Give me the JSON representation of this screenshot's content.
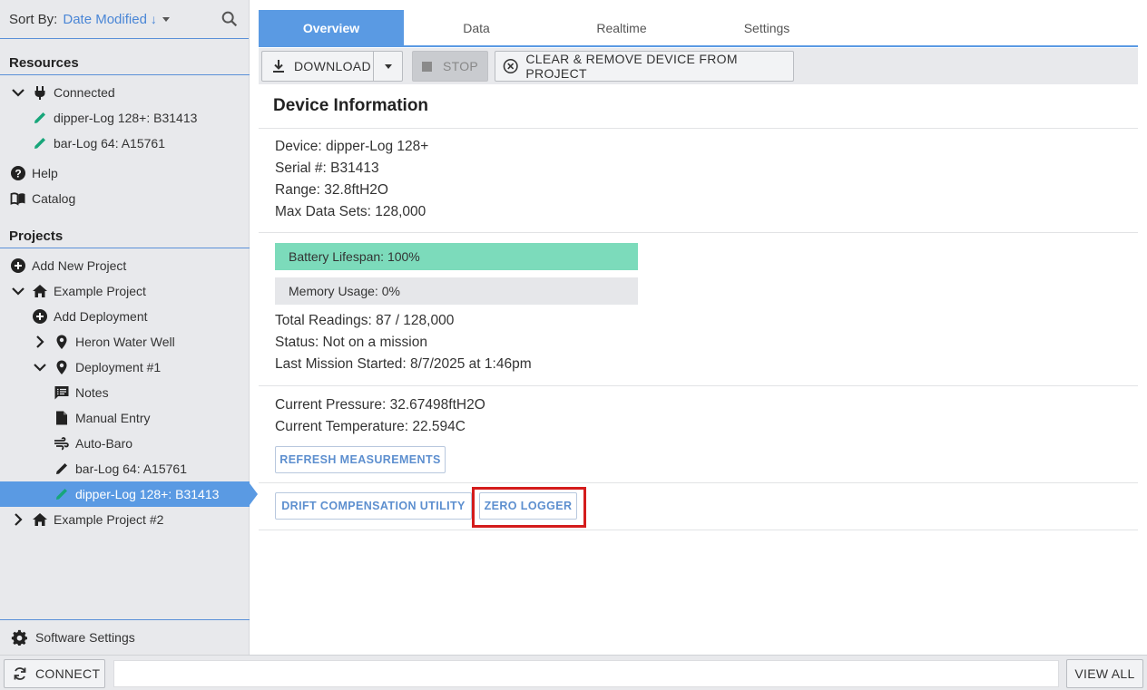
{
  "sidebar": {
    "sort_label": "Sort By:",
    "sort_value": "Date Modified",
    "resources_title": "Resources",
    "connected": "Connected",
    "connected_devices": [
      "dipper-Log 128+: B31413",
      "bar-Log 64: A15761"
    ],
    "help": "Help",
    "catalog": "Catalog",
    "projects_title": "Projects",
    "add_new_project": "Add New Project",
    "example_project": "Example Project",
    "add_deployment": "Add Deployment",
    "heron_water_well": "Heron Water Well",
    "deployment_1": "Deployment #1",
    "notes": "Notes",
    "manual_entry": "Manual Entry",
    "auto_baro": "Auto-Baro",
    "barlog": "bar-Log 64: A15761",
    "dipperlog": "dipper-Log 128+: B31413",
    "example_project_2": "Example Project #2",
    "software_settings": "Software Settings"
  },
  "tabs": [
    "Overview",
    "Data",
    "Realtime",
    "Settings"
  ],
  "toolbar": {
    "download": "DOWNLOAD",
    "stop": "STOP",
    "clear_remove": "CLEAR & REMOVE DEVICE FROM PROJECT"
  },
  "device": {
    "header": "Device Information",
    "device": "Device: dipper-Log 128+",
    "serial": "Serial #: B31413",
    "range": "Range: 32.8ftH2O",
    "max_data_sets": "Max Data Sets: 128,000",
    "battery_label": "Battery Lifespan: 100%",
    "battery_fraction": 1.0,
    "memory_label": "Memory Usage: 0%",
    "memory_fraction": 0.0,
    "total_readings": "Total Readings: 87 / 128,000",
    "status": "Status: Not on a mission",
    "last_mission": "Last Mission Started: 8/7/2025 at 1:46pm",
    "current_pressure": "Current Pressure: 32.67498ftH2O",
    "current_temperature": "Current Temperature: 22.594C",
    "refresh_btn": "REFRESH MEASUREMENTS",
    "drift_btn": "DRIFT COMPENSATION UTILITY",
    "zero_btn": "ZERO LOGGER"
  },
  "bottombar": {
    "connect": "CONNECT",
    "view_all": "VIEW ALL"
  },
  "colors": {
    "accent": "#5a9ae3",
    "battery_fill": "#7cdbbb",
    "memory_bg": "#e6e7ea",
    "highlight": "#d41c1c",
    "pencil_green": "#17a67a"
  }
}
